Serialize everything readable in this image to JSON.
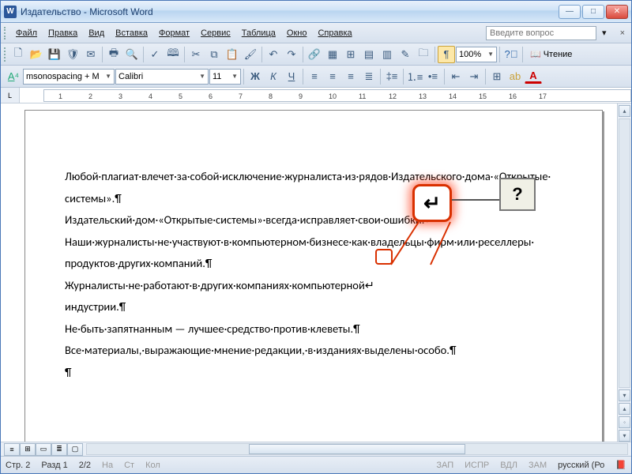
{
  "window": {
    "title": "Издательство - Microsoft Word"
  },
  "menu": {
    "file": "Файл",
    "edit": "Правка",
    "view": "Вид",
    "insert": "Вставка",
    "format": "Формат",
    "service": "Сервис",
    "table": "Таблица",
    "window": "Окно",
    "help": "Справка",
    "help_placeholder": "Введите вопрос"
  },
  "toolbar1": {
    "zoom": "100%",
    "reading": "Чтение"
  },
  "toolbar2": {
    "style": "msonospacing + М",
    "font": "Calibri",
    "size": "11"
  },
  "ruler": {
    "marks": [
      "1",
      "2",
      "3",
      "4",
      "5",
      "6",
      "7",
      "8",
      "9",
      "10",
      "11",
      "12",
      "13",
      "14",
      "15",
      "16",
      "17"
    ]
  },
  "document": {
    "lines": [
      "Любой·плагиат·влечет·за·собой·исключение·журналиста·из·рядов·Издательского·дома·«Открытые·",
      "системы».¶",
      "Издательский·дом·«Открытые·системы»·всегда·исправляет·свои·ошибки.↵",
      "Наши·журналисты·не·участвуют·в·компьютерном·бизнесе·как·владельцы·фирм·или·реселлеры·",
      "продуктов·других·компаний.¶",
      "Журналисты·не·работают·в·других·компаниях·компьютерной↵",
      "индустрии.¶",
      "Не·быть·запятнанным — лучшее·средство·против·клеветы.¶",
      "Все·материалы,·выражающие·мнение·редакции,·в·изданиях·выделены·особо.¶",
      "        ¶"
    ]
  },
  "callout": {
    "symbol": "↵",
    "question": "?"
  },
  "statusbar": {
    "page": "Стр. 2",
    "section": "Разд 1",
    "pages": "2/2",
    "at": "На",
    "line": "Ст",
    "col": "Кол",
    "rec": "ЗАП",
    "trk": "ИСПР",
    "ext": "ВДЛ",
    "ovr": "ЗАМ",
    "lang": "русский (Ро"
  }
}
